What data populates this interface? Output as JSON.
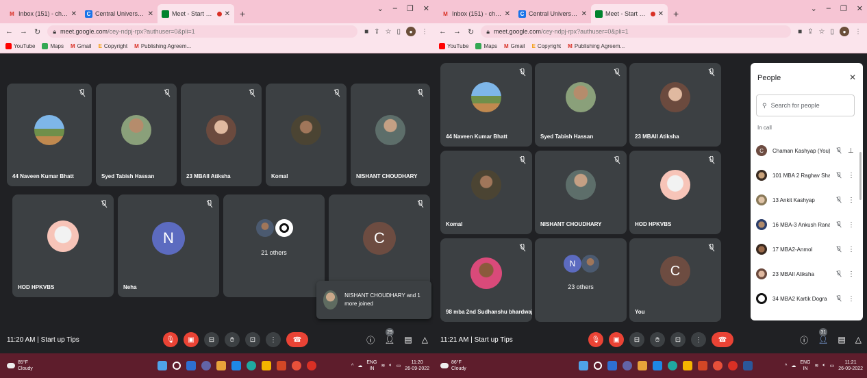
{
  "left": {
    "tabs": [
      {
        "label": "Inbox (151) - chamankashyap19",
        "fav": "M",
        "color": "#d93025"
      },
      {
        "label": "Central University of Himachal P",
        "fav": "C",
        "color": "#1a73e8"
      },
      {
        "label": "Meet - Start up Tips",
        "fav": "",
        "color": "#00832d"
      }
    ],
    "url_host": "meet.google.com",
    "url_path": "/cey-ndpj-rpx?authuser=0&pli=1",
    "bookmarks": [
      "YouTube",
      "Maps",
      "Gmail",
      "Copyright",
      "Publishing Agreem..."
    ],
    "tiles": [
      {
        "name": "44 Naveen Kumar Bhatt"
      },
      {
        "name": "Syed Tabish Hassan"
      },
      {
        "name": "23 MBAII Atiksha"
      },
      {
        "name": "Komal"
      },
      {
        "name": "NISHANT CHOUDHARY"
      },
      {
        "name": "HOD HPKVBS"
      },
      {
        "name": "Neha",
        "letter": "N"
      },
      {
        "name": "21 others"
      },
      {
        "letter": "C"
      }
    ],
    "toast": "NISHANT CHOUDHARY and 1 more joined",
    "time": "11:20 AM",
    "meeting": "Start up Tips",
    "people_count": "29",
    "weather_temp": "85°F",
    "weather_desc": "Cloudy",
    "tray_lang": "ENG",
    "tray_region": "IN",
    "clock_time": "11:20",
    "clock_date": "26-09-2022"
  },
  "right": {
    "tabs": [
      {
        "label": "Inbox (151) - chamankashyap19",
        "fav": "M",
        "color": "#d93025"
      },
      {
        "label": "Central University of Himachal P",
        "fav": "C",
        "color": "#1a73e8"
      },
      {
        "label": "Meet - Start up Tips",
        "fav": "",
        "color": "#00832d"
      }
    ],
    "url_host": "meet.google.com",
    "url_path": "/cey-ndpj-rpx?authuser=0&pli=1",
    "bookmarks": [
      "YouTube",
      "Maps",
      "Gmail",
      "Copyright",
      "Publishing Agreem..."
    ],
    "tiles": [
      {
        "name": "44 Naveen Kumar Bhatt"
      },
      {
        "name": "Syed Tabish Hassan"
      },
      {
        "name": "23 MBAII Atiksha"
      },
      {
        "name": "Komal"
      },
      {
        "name": "NISHANT CHOUDHARY"
      },
      {
        "name": "HOD HPKVBS"
      },
      {
        "name": "98 mba 2nd Sudhanshu bhardwaj"
      },
      {
        "name": "23 others"
      },
      {
        "name": "You",
        "letter": "C"
      }
    ],
    "panel": {
      "title": "People",
      "search_placeholder": "Search for people",
      "section": "In call",
      "people": [
        {
          "name": "Chaman Kashyap (You)",
          "initial": "C"
        },
        {
          "name": "101 MBA 2 Raghav Sharma"
        },
        {
          "name": "13 Ankit Kashyap"
        },
        {
          "name": "16 MBA-3 Ankush Rana"
        },
        {
          "name": "17 MBA2-Anmol"
        },
        {
          "name": "23 MBAII Atiksha"
        },
        {
          "name": "34 MBA2 Kartik Dogra"
        }
      ]
    },
    "time": "11:21 AM",
    "meeting": "Start up Tips",
    "people_count": "31",
    "weather_temp": "86°F",
    "weather_desc": "Cloudy",
    "tray_lang": "ENG",
    "tray_region": "IN",
    "clock_time": "11:21",
    "clock_date": "26-09-2022"
  },
  "colors": {
    "accent_red": "#ea4335",
    "tile_bg": "#3c4043",
    "meet_bg": "#202124",
    "taskbar": "#5e1d2c"
  }
}
